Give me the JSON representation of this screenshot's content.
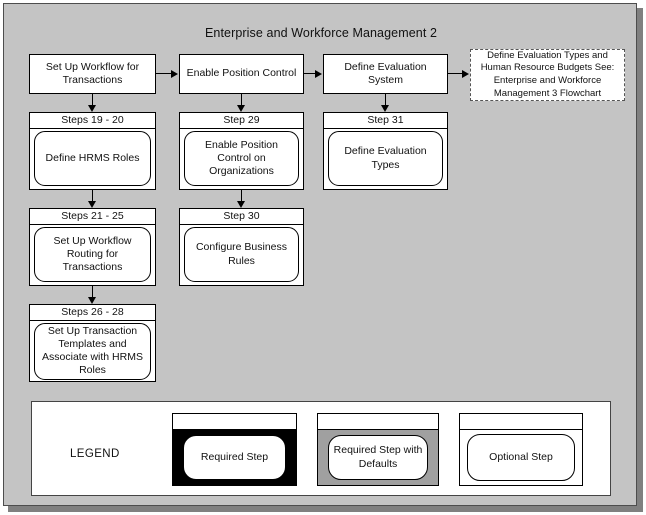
{
  "diagram": {
    "title": "Enterprise and Workforce Management 2",
    "columns": [
      {
        "header": "Set Up Workflow for Transactions",
        "steps": [
          {
            "label": "Steps 19 - 20",
            "text": "Define HRMS Roles"
          },
          {
            "label": "Steps 21 - 25",
            "text": "Set Up Workflow Routing for Transactions"
          },
          {
            "label": "Steps 26 - 28",
            "text": "Set Up Transaction Templates and Associate with HRMS Roles"
          }
        ]
      },
      {
        "header": "Enable Position Control",
        "steps": [
          {
            "label": "Step 29",
            "text": "Enable Position Control on Organizations"
          },
          {
            "label": "Step 30",
            "text": "Configure Business Rules"
          }
        ]
      },
      {
        "header": "Define Evaluation System",
        "steps": [
          {
            "label": "Step 31",
            "text": "Define Evaluation Types"
          }
        ]
      }
    ],
    "reference": {
      "text": "Define Evaluation Types and Human Resource Budgets See: Enterprise and Workforce Management 3 Flowchart"
    }
  },
  "legend": {
    "title": "LEGEND",
    "items": [
      {
        "key": "required",
        "label": "Required Step"
      },
      {
        "key": "defaults",
        "label": "Required Step with Defaults"
      },
      {
        "key": "optional",
        "label": "Optional Step"
      }
    ]
  },
  "colors": {
    "background": "#c4c4c4",
    "stroke": "#000000",
    "required_fill": "#000000",
    "defaults_fill": "#a0a0a0",
    "optional_fill": "#ffffff",
    "panel": "#ffffff"
  }
}
